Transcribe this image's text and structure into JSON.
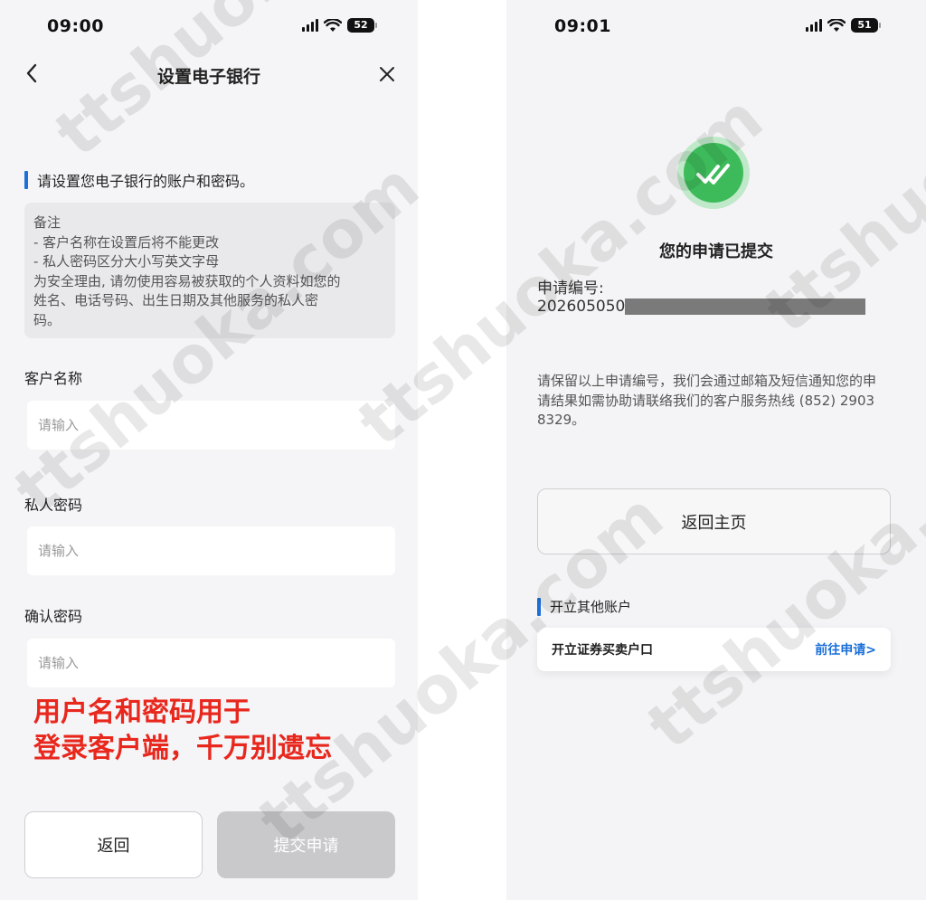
{
  "left_screen": {
    "status": {
      "time": "09:00",
      "battery": "52"
    },
    "nav": {
      "title": "设置电子银行"
    },
    "section_heading": "请设置您电子银行的账户和密码。",
    "note": {
      "lines": [
        "备注",
        "- 客户名称在设置后将不能更改",
        "- 私人密码区分大小写英文字母",
        "为安全理由, 请勿使用容易被获取的个人资料如您的",
        "姓名、电话号码、出生日期及其他服务的私人密",
        "码。"
      ]
    },
    "fields": [
      {
        "label": "客户名称",
        "value": "",
        "placeholder": "请输入"
      },
      {
        "label": "私人密码",
        "value": "",
        "placeholder": "请输入"
      },
      {
        "label": "确认密码",
        "value": "",
        "placeholder": "请输入"
      }
    ],
    "overlay_note": {
      "line1": "用户名和密码用于",
      "line2": "登录客户端，千万别遗忘"
    },
    "buttons": {
      "back": "返回",
      "submit": "提交申请"
    }
  },
  "right_screen": {
    "status": {
      "time": "09:01",
      "battery": "51"
    },
    "success_title": "您的申请已提交",
    "application_no_label": "申请编号:",
    "application_no_prefix": "202605050",
    "notice": "请保留以上申请编号，我们会通过邮箱及短信通知您的申请结果如需协助请联络我们的客户服务热线 (852) 2903 8329。",
    "home_button": "返回主页",
    "other_accounts_heading": "开立其他账户",
    "other_accounts_card": {
      "title": "开立证券买卖户口",
      "link": "前往申请>"
    }
  },
  "watermark": "ttshuoka.com",
  "colors": {
    "accent_blue": "#1a6fd8",
    "success_green": "#3dbb5b",
    "warning_red": "#e8271d",
    "disabled_button": "#c9c9cc"
  },
  "icons": [
    "chevron-left-icon",
    "close-icon",
    "signal-icon",
    "wifi-icon",
    "battery-icon",
    "double-check-icon"
  ]
}
